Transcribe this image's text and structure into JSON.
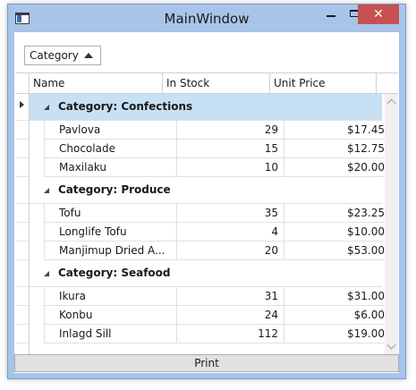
{
  "window": {
    "title": "MainWindow",
    "controls": {
      "minimize": "",
      "maximize": "",
      "close": "✕"
    }
  },
  "combo": {
    "selected": "Category"
  },
  "grid": {
    "columns": [
      "Name",
      "In Stock",
      "Unit Price"
    ],
    "groups": [
      {
        "label": "Category: Confections",
        "selected": true,
        "rows": [
          {
            "name": "Pavlova",
            "stock": "29",
            "price": "$17.45"
          },
          {
            "name": "Chocolade",
            "stock": "15",
            "price": "$12.75"
          },
          {
            "name": "Maxilaku",
            "stock": "10",
            "price": "$20.00"
          }
        ]
      },
      {
        "label": "Category: Produce",
        "selected": false,
        "rows": [
          {
            "name": "Tofu",
            "stock": "35",
            "price": "$23.25"
          },
          {
            "name": "Longlife Tofu",
            "stock": "4",
            "price": "$10.00"
          },
          {
            "name": "Manjimup Dried A...",
            "stock": "20",
            "price": "$53.00"
          }
        ]
      },
      {
        "label": "Category: Seafood",
        "selected": false,
        "rows": [
          {
            "name": "Ikura",
            "stock": "31",
            "price": "$31.00"
          },
          {
            "name": "Konbu",
            "stock": "24",
            "price": "$6.00"
          },
          {
            "name": "Inlagd Sill",
            "stock": "112",
            "price": "$19.00"
          }
        ]
      }
    ]
  },
  "footer": {
    "print_label": "Print"
  },
  "colors": {
    "selected_group": "#c7e0f4",
    "close_button": "#c75050",
    "window_frame": "#a8c4e8"
  },
  "icons": {
    "app": "window-app-icon",
    "group_toggle": "collapse-triangle-icon",
    "current_row": "row-pointer-icon"
  }
}
